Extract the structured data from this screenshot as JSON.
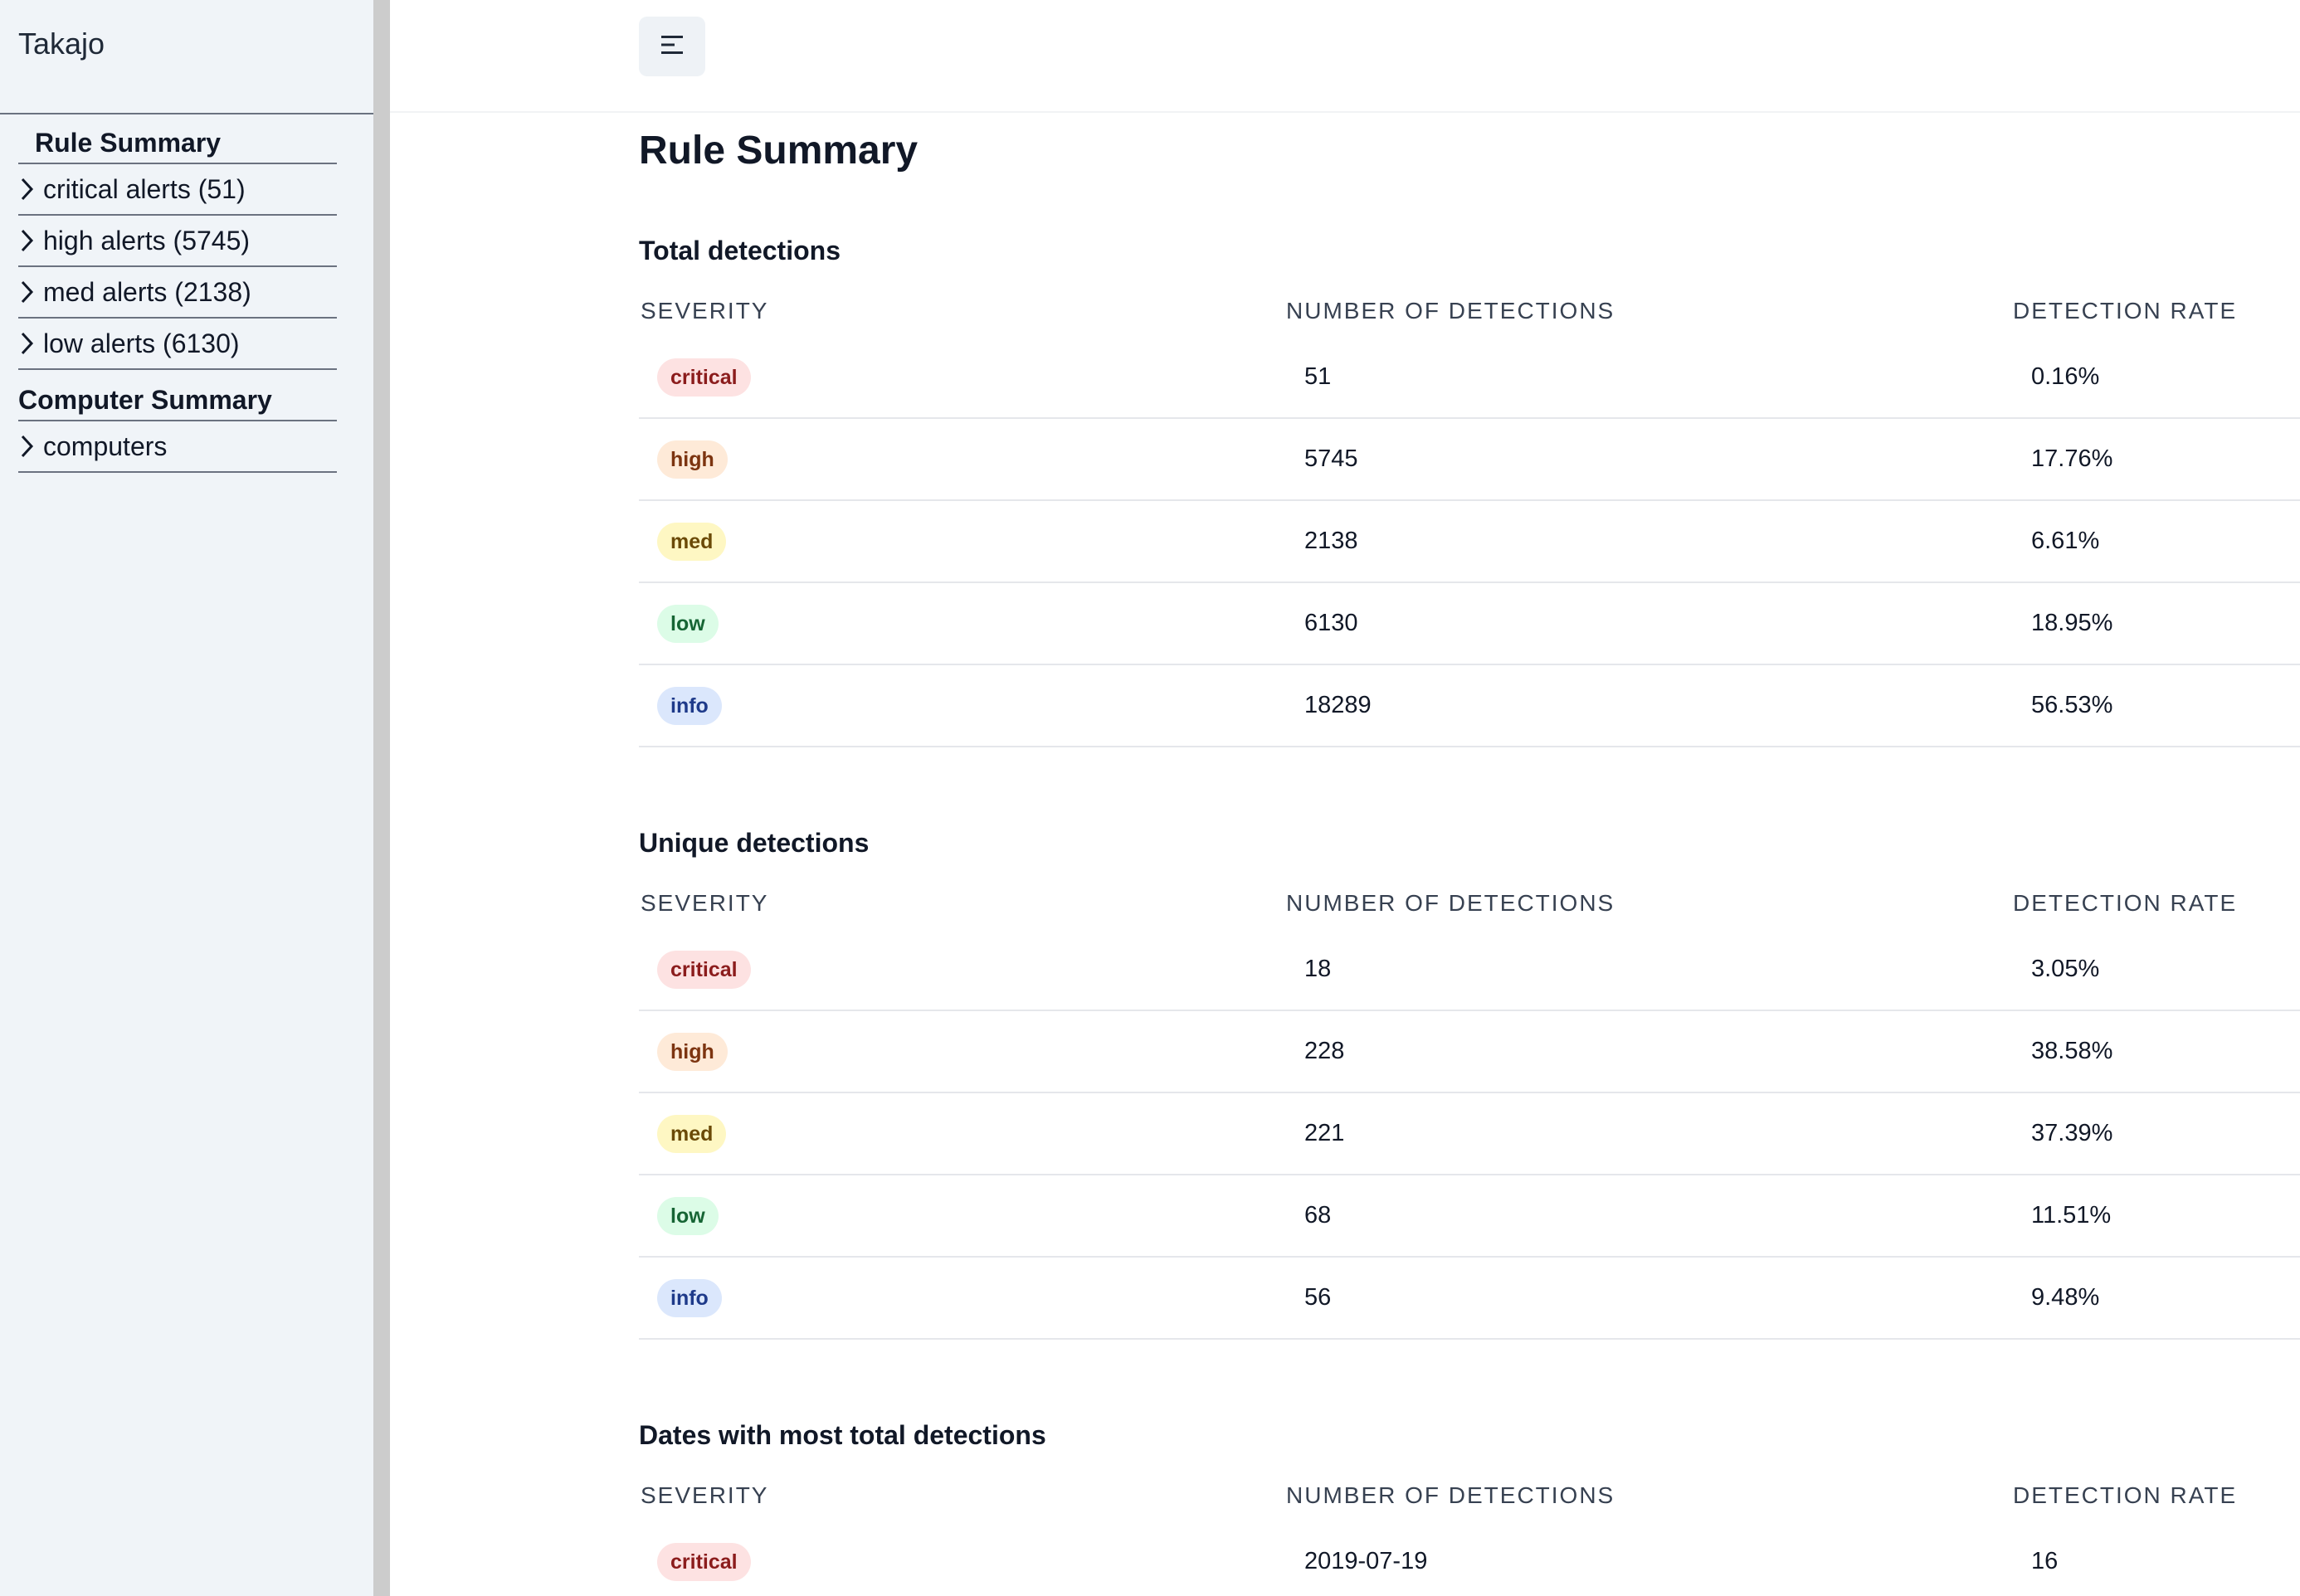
{
  "sidebar": {
    "brand": "Takajo",
    "rule_summary_heading": "Rule Summary",
    "rule_items": [
      {
        "label": "critical alerts (51)"
      },
      {
        "label": "high alerts (5745)"
      },
      {
        "label": "med alerts (2138)"
      },
      {
        "label": "low alerts (6130)"
      }
    ],
    "computer_summary_heading": "Computer Summary",
    "computer_items": [
      {
        "label": "computers"
      }
    ]
  },
  "header": {
    "menu_icon": "menu-icon"
  },
  "main": {
    "page_title": "Rule Summary",
    "total": {
      "title": "Total detections",
      "headers": [
        "Severity",
        "Number of detections",
        "Detection rate"
      ],
      "rows": [
        {
          "severity": "critical",
          "count": "51",
          "rate": "0.16%"
        },
        {
          "severity": "high",
          "count": "5745",
          "rate": "17.76%"
        },
        {
          "severity": "med",
          "count": "2138",
          "rate": "6.61%"
        },
        {
          "severity": "low",
          "count": "6130",
          "rate": "18.95%"
        },
        {
          "severity": "info",
          "count": "18289",
          "rate": "56.53%"
        }
      ]
    },
    "unique": {
      "title": "Unique detections",
      "headers": [
        "Severity",
        "Number of detections",
        "Detection rate"
      ],
      "rows": [
        {
          "severity": "critical",
          "count": "18",
          "rate": "3.05%"
        },
        {
          "severity": "high",
          "count": "228",
          "rate": "38.58%"
        },
        {
          "severity": "med",
          "count": "221",
          "rate": "37.39%"
        },
        {
          "severity": "low",
          "count": "68",
          "rate": "11.51%"
        },
        {
          "severity": "info",
          "count": "56",
          "rate": "9.48%"
        }
      ]
    },
    "dates": {
      "title": "Dates with most total detections",
      "headers": [
        "Severity",
        "Number of detections",
        "Detection rate"
      ],
      "rows": [
        {
          "severity": "critical",
          "count": "2019-07-19",
          "rate": "16"
        }
      ]
    }
  },
  "colors": {
    "sidebar_bg": "#f0f4f8",
    "critical_bg": "#fde2e2",
    "high_bg": "#feead8",
    "med_bg": "#fef7c3",
    "low_bg": "#dcfce7",
    "info_bg": "#dbe7fc"
  }
}
